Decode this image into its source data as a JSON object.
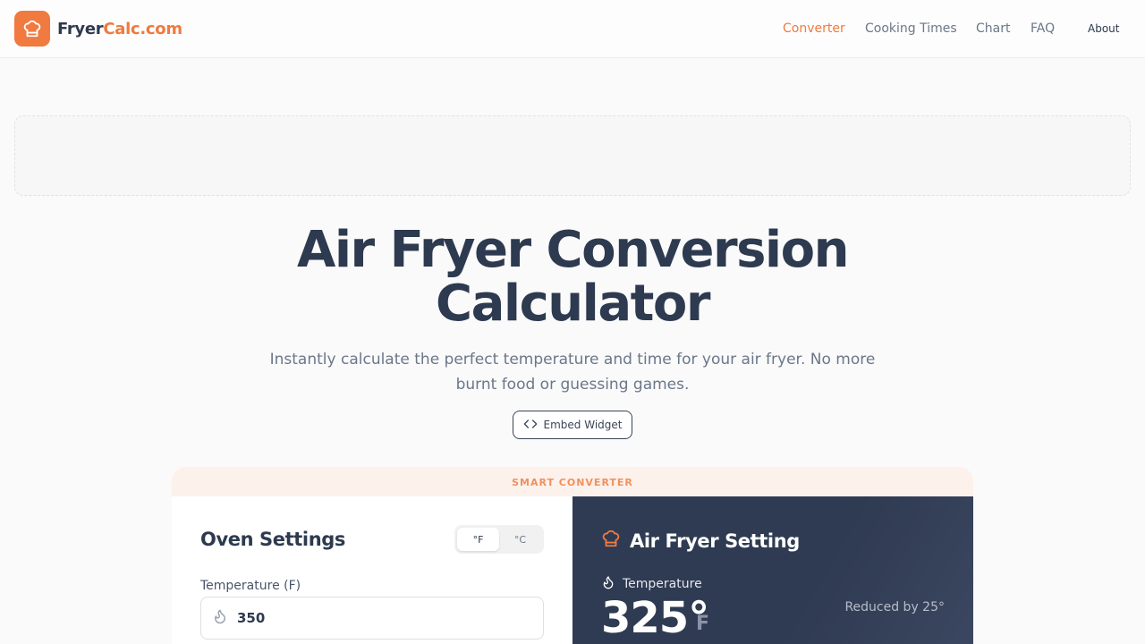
{
  "header": {
    "logo_part1": "Fryer",
    "logo_part2": "Calc.com",
    "nav": {
      "converter": "Converter",
      "cooking_times": "Cooking Times",
      "chart": "Chart",
      "faq": "FAQ",
      "about": "About"
    },
    "active_nav": "Converter"
  },
  "hero": {
    "title_line1": "Air Fryer Conversion",
    "title_line2": "Calculator",
    "subtitle_line1": "Instantly calculate the perfect temperature and time for your air fryer. No more",
    "subtitle_line2": "burnt food or guessing games.",
    "embed_button": "Embed Widget"
  },
  "converter": {
    "tab_label": "SMART CONVERTER",
    "oven": {
      "title": "Oven Settings",
      "unit_options": [
        "°F",
        "°C"
      ],
      "selected_unit": "°F",
      "temperature_label": "Temperature (F)",
      "temperature_value": "350"
    },
    "air_fryer": {
      "title": "Air Fryer Setting",
      "temperature_label": "Temperature",
      "temperature_value": "325°",
      "temperature_unit": "F",
      "reduced_note": "Reduced by 25°"
    }
  },
  "colors": {
    "accent": "#f07a3f",
    "dark_panel": "#2f3b52",
    "text_dark": "#2d3a4f",
    "text_muted": "#6b7789"
  },
  "icons": {
    "logo": "chef-hat-icon",
    "embed": "code-icon",
    "temperature": "flame-icon",
    "air_fryer": "chef-hat-icon"
  }
}
